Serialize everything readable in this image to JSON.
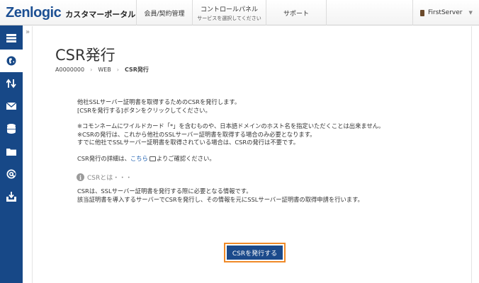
{
  "header": {
    "logo": "Zenlogic",
    "portal_name": "カスタマーポータル",
    "nav": [
      {
        "label": "会員/契約管理",
        "sub": ""
      },
      {
        "label": "コントロールパネル",
        "sub": "サービスを選択してください"
      },
      {
        "label": "サポート",
        "sub": ""
      }
    ],
    "user": {
      "name": "FirstServer",
      "caret": "▼"
    }
  },
  "sidebar": {
    "items": [
      {
        "icon": "server-icon"
      },
      {
        "icon": "globe-icon"
      },
      {
        "icon": "transfer-arrows-icon"
      },
      {
        "icon": "mail-icon"
      },
      {
        "icon": "database-icon"
      },
      {
        "icon": "folder-icon"
      },
      {
        "icon": "at-sign-icon"
      },
      {
        "icon": "download-box-icon"
      }
    ],
    "collapse": "»",
    "active_index": 1
  },
  "page": {
    "title": "CSR発行",
    "breadcrumb": [
      "A0000000",
      "WEB",
      "CSR発行"
    ],
    "breadcrumb_sep": "›"
  },
  "body": {
    "p1": [
      "他社SSLサーバー証明書を取得するためのCSRを発行します。",
      "[CSRを発行する]ボタンをクリックしてください。"
    ],
    "p2": [
      "※コモンネームにワイルドカード「*」を含むものや、日本語ドメインのホスト名を指定いただくことは出来ません。",
      "※CSRの発行は、これから他社のSSLサーバー証明書を取得する場合のみ必要となります。",
      "すでに他社でSSLサーバー証明書を取得されている場合は、CSRの発行は不要です。"
    ],
    "p3": {
      "before": "CSR発行の詳細は、",
      "link": "こちら",
      "after": "よりご確認ください。"
    },
    "info_heading": "CSRとは・・・",
    "info_icon": "i",
    "p4": [
      "CSRは、SSLサーバー証明書を発行する際に必要となる情報です。",
      "該当証明書を導入するサーバーでCSRを発行し、その情報を元にSSLサーバー証明書の取得申請を行います。"
    ]
  },
  "actions": {
    "issue_csr": "CSRを発行する"
  },
  "colors": {
    "sidebar": "#174887",
    "button": "#1b4a8b",
    "highlight": "#f08a28",
    "link": "#1c5fb0"
  }
}
